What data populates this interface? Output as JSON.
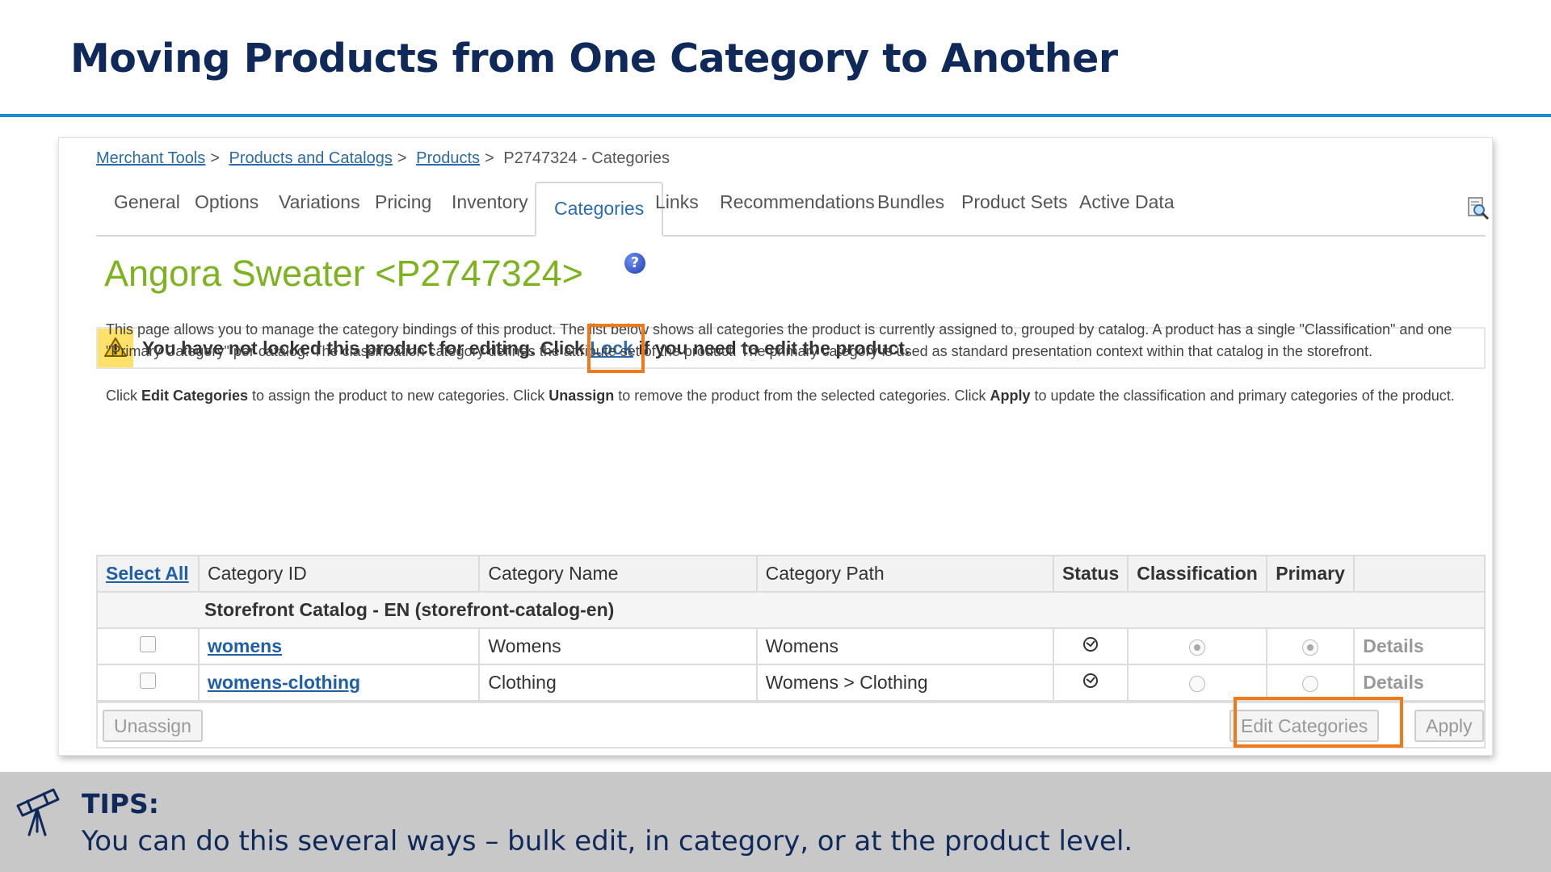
{
  "slide": {
    "title": "Moving Products from One Category to Another"
  },
  "breadcrumb": {
    "items": [
      "Merchant Tools",
      "Products and Catalogs",
      "Products"
    ],
    "current": "P2747324 - Categories",
    "separator": ">"
  },
  "tabs": [
    "General",
    "Options",
    "Variations",
    "Pricing",
    "Inventory",
    "Categories",
    "Links",
    "Recommendations",
    "Bundles",
    "Product Sets",
    "Active Data"
  ],
  "active_tab": "Categories",
  "product": {
    "title": "Angora Sweater <P2747324>",
    "help_glyph": "?"
  },
  "warning": {
    "before": "You have not locked this product for editing. Click ",
    "link": "Lock",
    "after": " if you need to edit the product."
  },
  "description": {
    "para1": "This page allows you to manage the category bindings of this product. The list below shows all categories the product is currently assigned to, grouped by catalog. A product has a single \"Classification\" and one \"Primary Category\" per catalog. The classification category defines the attribute set of the product. The primary category is used as standard presentation context within that catalog in the storefront.",
    "para2_parts": [
      "Click ",
      "Edit Categories",
      " to assign the product to new categories. Click ",
      "Unassign",
      " to remove the product from the selected categories. Click ",
      "Apply",
      " to update the classification and primary categories of the product."
    ]
  },
  "table": {
    "headers": [
      "Select All",
      "Category ID",
      "Category Name",
      "Category Path",
      "Status",
      "Classification",
      "Primary",
      ""
    ],
    "group": "Storefront Catalog - EN (storefront-catalog-en)",
    "rows": [
      {
        "id": "womens",
        "name": "Womens",
        "path": "Womens",
        "details": "Details",
        "classification_selected": true,
        "primary_selected": true
      },
      {
        "id": "womens-clothing",
        "name": "Clothing",
        "path": "Womens > Clothing",
        "details": "Details",
        "classification_selected": false,
        "primary_selected": false
      }
    ]
  },
  "buttons": {
    "unassign": "Unassign",
    "edit_categories": "Edit Categories",
    "apply": "Apply"
  },
  "tips": {
    "title": "TIPS:",
    "text": "You can do this several ways – bulk edit, in category, or at the product level."
  },
  "colors": {
    "title_navy": "#0f2a5a",
    "rule_blue": "#1a8cd0",
    "product_green": "#7cb31f",
    "highlight_orange": "#ef7a17",
    "link_blue": "#2b6aa8",
    "tips_band_gray": "#c8c8c8"
  },
  "icons": [
    "magnifier-page-icon",
    "help-icon",
    "warning-icon",
    "status-icon",
    "telescope-icon"
  ]
}
